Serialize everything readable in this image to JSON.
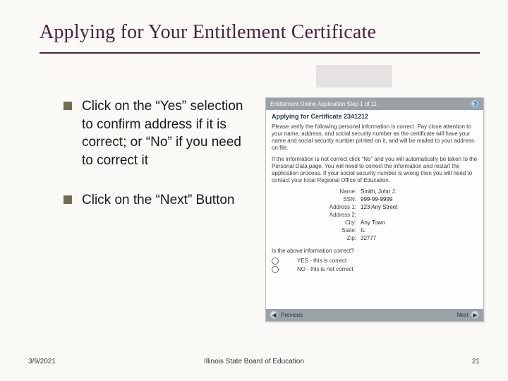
{
  "title": "Applying for Your Entitlement Certificate",
  "bullets": {
    "b1": "Click on the “Yes” selection to confirm address if it is correct; or “No” if you need to correct it",
    "b2": "Click on the “Next” Button"
  },
  "panel": {
    "header": "Entitlement Online Application Step 1 of 11",
    "help_alt": "?",
    "subtitle": "Applying for Certificate 2341212",
    "para1": "Please verify the following personal information is correct. Pay close attention to your name, address, and social security number as the certificate will have your name and social security number printed on it, and will be mailed to your address on file.",
    "para2": "If the information is not correct click “No” and you will automatically be taken to the Personal Data page. You will need to correct the information and restart the application process. If your social security number is wrong then you will need to contact your local Regional Office of Education.",
    "rows": {
      "name": {
        "lbl": "Name:",
        "val": "Smith, John J."
      },
      "ssn": {
        "lbl": "SSN:",
        "val": "999-99-9999"
      },
      "addr1": {
        "lbl": "Address 1:",
        "val": "123 Any Street"
      },
      "addr2": {
        "lbl": "Address 2:",
        "val": ""
      },
      "city": {
        "lbl": "City:",
        "val": "Any Town"
      },
      "state": {
        "lbl": "State:",
        "val": "IL"
      },
      "zip": {
        "lbl": "Zip:",
        "val": "32777"
      }
    },
    "question": "Is the above information correct?",
    "yes": "YES - this is correct",
    "no": "NO - this is not correct",
    "prev": "Previous",
    "next": "Next",
    "arrow_left": "◀",
    "arrow_right": "▶"
  },
  "footer": {
    "date": "3/9/2021",
    "center": "Illinois State Board of Education",
    "page": "21"
  }
}
